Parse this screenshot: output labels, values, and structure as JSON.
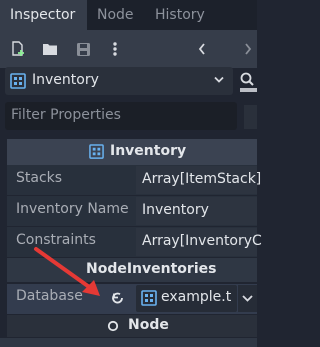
{
  "tabs": [
    {
      "label": "Inspector"
    },
    {
      "label": "Node"
    },
    {
      "label": "History"
    }
  ],
  "toolbar": {
    "icons": [
      "new-resource-icon",
      "open-folder-icon",
      "save-icon",
      "more-options-icon",
      "history-back-icon",
      "history-forward-icon"
    ]
  },
  "object_selector": {
    "label": "Inventory",
    "icon": "inventory-class-icon",
    "side_icon": "documentation-icon"
  },
  "filter": {
    "placeholder": "Filter Properties"
  },
  "section": {
    "title": "Inventory"
  },
  "properties": [
    {
      "label": "Stacks",
      "value": "Array[ItemStack]"
    },
    {
      "label": "Inventory Name",
      "value": "Inventory"
    },
    {
      "label": "Constraints",
      "value": "Array[InventoryC"
    }
  ],
  "subsection": {
    "title": "NodeInventories"
  },
  "database": {
    "label": "Database",
    "value": "example.t",
    "revert_icon": "revert-icon"
  },
  "node_section": {
    "title": "Node"
  },
  "colors": {
    "background": "#202531",
    "annotation_arrow": "#e53935",
    "accent": "#69b2f0"
  }
}
